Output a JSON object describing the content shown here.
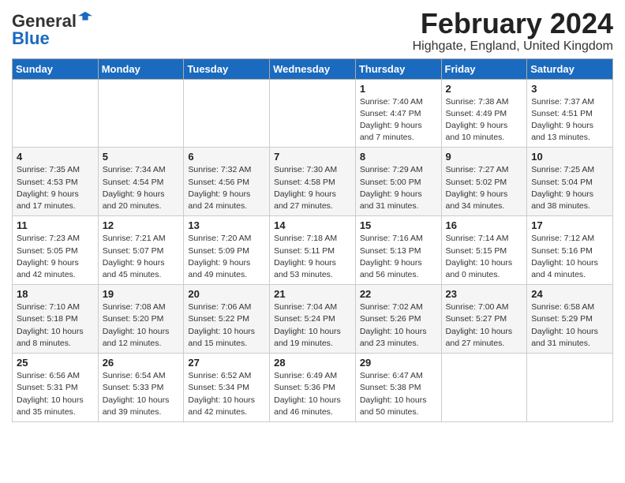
{
  "header": {
    "logo_general": "General",
    "logo_blue": "Blue",
    "title": "February 2024",
    "subtitle": "Highgate, England, United Kingdom"
  },
  "days_of_week": [
    "Sunday",
    "Monday",
    "Tuesday",
    "Wednesday",
    "Thursday",
    "Friday",
    "Saturday"
  ],
  "weeks": [
    [
      {
        "day": "",
        "info": ""
      },
      {
        "day": "",
        "info": ""
      },
      {
        "day": "",
        "info": ""
      },
      {
        "day": "",
        "info": ""
      },
      {
        "day": "1",
        "info": "Sunrise: 7:40 AM\nSunset: 4:47 PM\nDaylight: 9 hours\nand 7 minutes."
      },
      {
        "day": "2",
        "info": "Sunrise: 7:38 AM\nSunset: 4:49 PM\nDaylight: 9 hours\nand 10 minutes."
      },
      {
        "day": "3",
        "info": "Sunrise: 7:37 AM\nSunset: 4:51 PM\nDaylight: 9 hours\nand 13 minutes."
      }
    ],
    [
      {
        "day": "4",
        "info": "Sunrise: 7:35 AM\nSunset: 4:53 PM\nDaylight: 9 hours\nand 17 minutes."
      },
      {
        "day": "5",
        "info": "Sunrise: 7:34 AM\nSunset: 4:54 PM\nDaylight: 9 hours\nand 20 minutes."
      },
      {
        "day": "6",
        "info": "Sunrise: 7:32 AM\nSunset: 4:56 PM\nDaylight: 9 hours\nand 24 minutes."
      },
      {
        "day": "7",
        "info": "Sunrise: 7:30 AM\nSunset: 4:58 PM\nDaylight: 9 hours\nand 27 minutes."
      },
      {
        "day": "8",
        "info": "Sunrise: 7:29 AM\nSunset: 5:00 PM\nDaylight: 9 hours\nand 31 minutes."
      },
      {
        "day": "9",
        "info": "Sunrise: 7:27 AM\nSunset: 5:02 PM\nDaylight: 9 hours\nand 34 minutes."
      },
      {
        "day": "10",
        "info": "Sunrise: 7:25 AM\nSunset: 5:04 PM\nDaylight: 9 hours\nand 38 minutes."
      }
    ],
    [
      {
        "day": "11",
        "info": "Sunrise: 7:23 AM\nSunset: 5:05 PM\nDaylight: 9 hours\nand 42 minutes."
      },
      {
        "day": "12",
        "info": "Sunrise: 7:21 AM\nSunset: 5:07 PM\nDaylight: 9 hours\nand 45 minutes."
      },
      {
        "day": "13",
        "info": "Sunrise: 7:20 AM\nSunset: 5:09 PM\nDaylight: 9 hours\nand 49 minutes."
      },
      {
        "day": "14",
        "info": "Sunrise: 7:18 AM\nSunset: 5:11 PM\nDaylight: 9 hours\nand 53 minutes."
      },
      {
        "day": "15",
        "info": "Sunrise: 7:16 AM\nSunset: 5:13 PM\nDaylight: 9 hours\nand 56 minutes."
      },
      {
        "day": "16",
        "info": "Sunrise: 7:14 AM\nSunset: 5:15 PM\nDaylight: 10 hours\nand 0 minutes."
      },
      {
        "day": "17",
        "info": "Sunrise: 7:12 AM\nSunset: 5:16 PM\nDaylight: 10 hours\nand 4 minutes."
      }
    ],
    [
      {
        "day": "18",
        "info": "Sunrise: 7:10 AM\nSunset: 5:18 PM\nDaylight: 10 hours\nand 8 minutes."
      },
      {
        "day": "19",
        "info": "Sunrise: 7:08 AM\nSunset: 5:20 PM\nDaylight: 10 hours\nand 12 minutes."
      },
      {
        "day": "20",
        "info": "Sunrise: 7:06 AM\nSunset: 5:22 PM\nDaylight: 10 hours\nand 15 minutes."
      },
      {
        "day": "21",
        "info": "Sunrise: 7:04 AM\nSunset: 5:24 PM\nDaylight: 10 hours\nand 19 minutes."
      },
      {
        "day": "22",
        "info": "Sunrise: 7:02 AM\nSunset: 5:26 PM\nDaylight: 10 hours\nand 23 minutes."
      },
      {
        "day": "23",
        "info": "Sunrise: 7:00 AM\nSunset: 5:27 PM\nDaylight: 10 hours\nand 27 minutes."
      },
      {
        "day": "24",
        "info": "Sunrise: 6:58 AM\nSunset: 5:29 PM\nDaylight: 10 hours\nand 31 minutes."
      }
    ],
    [
      {
        "day": "25",
        "info": "Sunrise: 6:56 AM\nSunset: 5:31 PM\nDaylight: 10 hours\nand 35 minutes."
      },
      {
        "day": "26",
        "info": "Sunrise: 6:54 AM\nSunset: 5:33 PM\nDaylight: 10 hours\nand 39 minutes."
      },
      {
        "day": "27",
        "info": "Sunrise: 6:52 AM\nSunset: 5:34 PM\nDaylight: 10 hours\nand 42 minutes."
      },
      {
        "day": "28",
        "info": "Sunrise: 6:49 AM\nSunset: 5:36 PM\nDaylight: 10 hours\nand 46 minutes."
      },
      {
        "day": "29",
        "info": "Sunrise: 6:47 AM\nSunset: 5:38 PM\nDaylight: 10 hours\nand 50 minutes."
      },
      {
        "day": "",
        "info": ""
      },
      {
        "day": "",
        "info": ""
      }
    ]
  ]
}
